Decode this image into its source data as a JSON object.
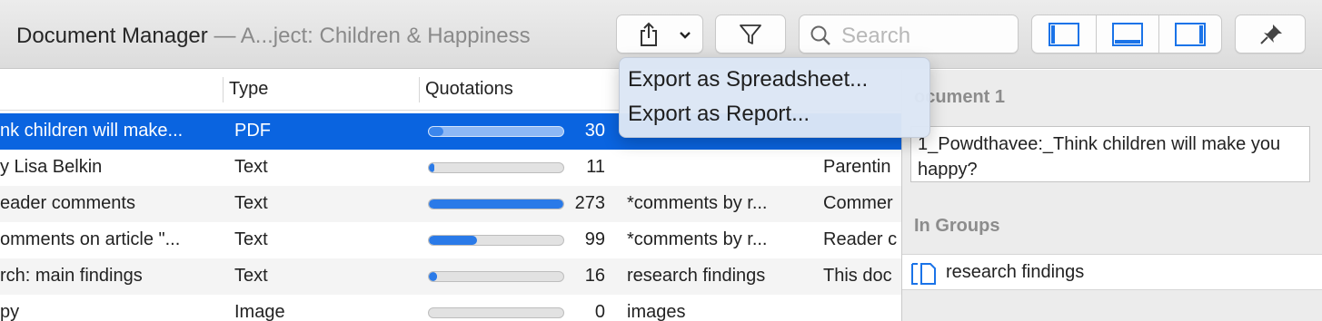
{
  "window": {
    "title": "Document Manager",
    "separator": " — ",
    "subtitle": "A...ject: Children & Happiness"
  },
  "toolbar": {
    "share_icon": "share-icon",
    "share_menu_icon": "chevron-down-icon",
    "filter_icon": "filter-icon",
    "search_icon": "search-icon",
    "search_placeholder": "Search",
    "layout_icons": [
      "sidebar-left-icon",
      "panel-bottom-icon",
      "sidebar-right-icon"
    ],
    "pin_icon": "pin-icon",
    "accent": "#1a73e8"
  },
  "table": {
    "columns": [
      "Type",
      "Quotations"
    ],
    "rows": [
      {
        "name": "nk children will make...",
        "type": "PDF",
        "quotations": 30,
        "bar_fraction": 0.11,
        "group": "",
        "comment": "",
        "selected": true
      },
      {
        "name": "y Lisa Belkin",
        "type": "Text",
        "quotations": 11,
        "bar_fraction": 0.04,
        "group": "",
        "comment": "Parentin"
      },
      {
        "name": "eader comments",
        "type": "Text",
        "quotations": 273,
        "bar_fraction": 1.0,
        "group": "*comments by r...",
        "comment": "Commer"
      },
      {
        "name": "omments on article \"...",
        "type": "Text",
        "quotations": 99,
        "bar_fraction": 0.36,
        "group": "*comments by r...",
        "comment": "Reader c"
      },
      {
        "name": "rch: main findings",
        "type": "Text",
        "quotations": 16,
        "bar_fraction": 0.06,
        "group": "research findings",
        "comment": "This doc"
      },
      {
        "name": "py",
        "type": "Image",
        "quotations": 0,
        "bar_fraction": 0.0,
        "group": "images",
        "comment": ""
      }
    ],
    "selection_color": "#0a64e0"
  },
  "export_menu": {
    "items": [
      "Export as Spreadsheet...",
      "Export as Report..."
    ]
  },
  "inspector": {
    "doc_heading": "ocument 1",
    "doc_name": "1_Powdthavee:_Think children will make you happy?",
    "groups_heading": "In Groups",
    "groups": [
      {
        "label": "research findings",
        "icon": "document-icon"
      }
    ]
  }
}
